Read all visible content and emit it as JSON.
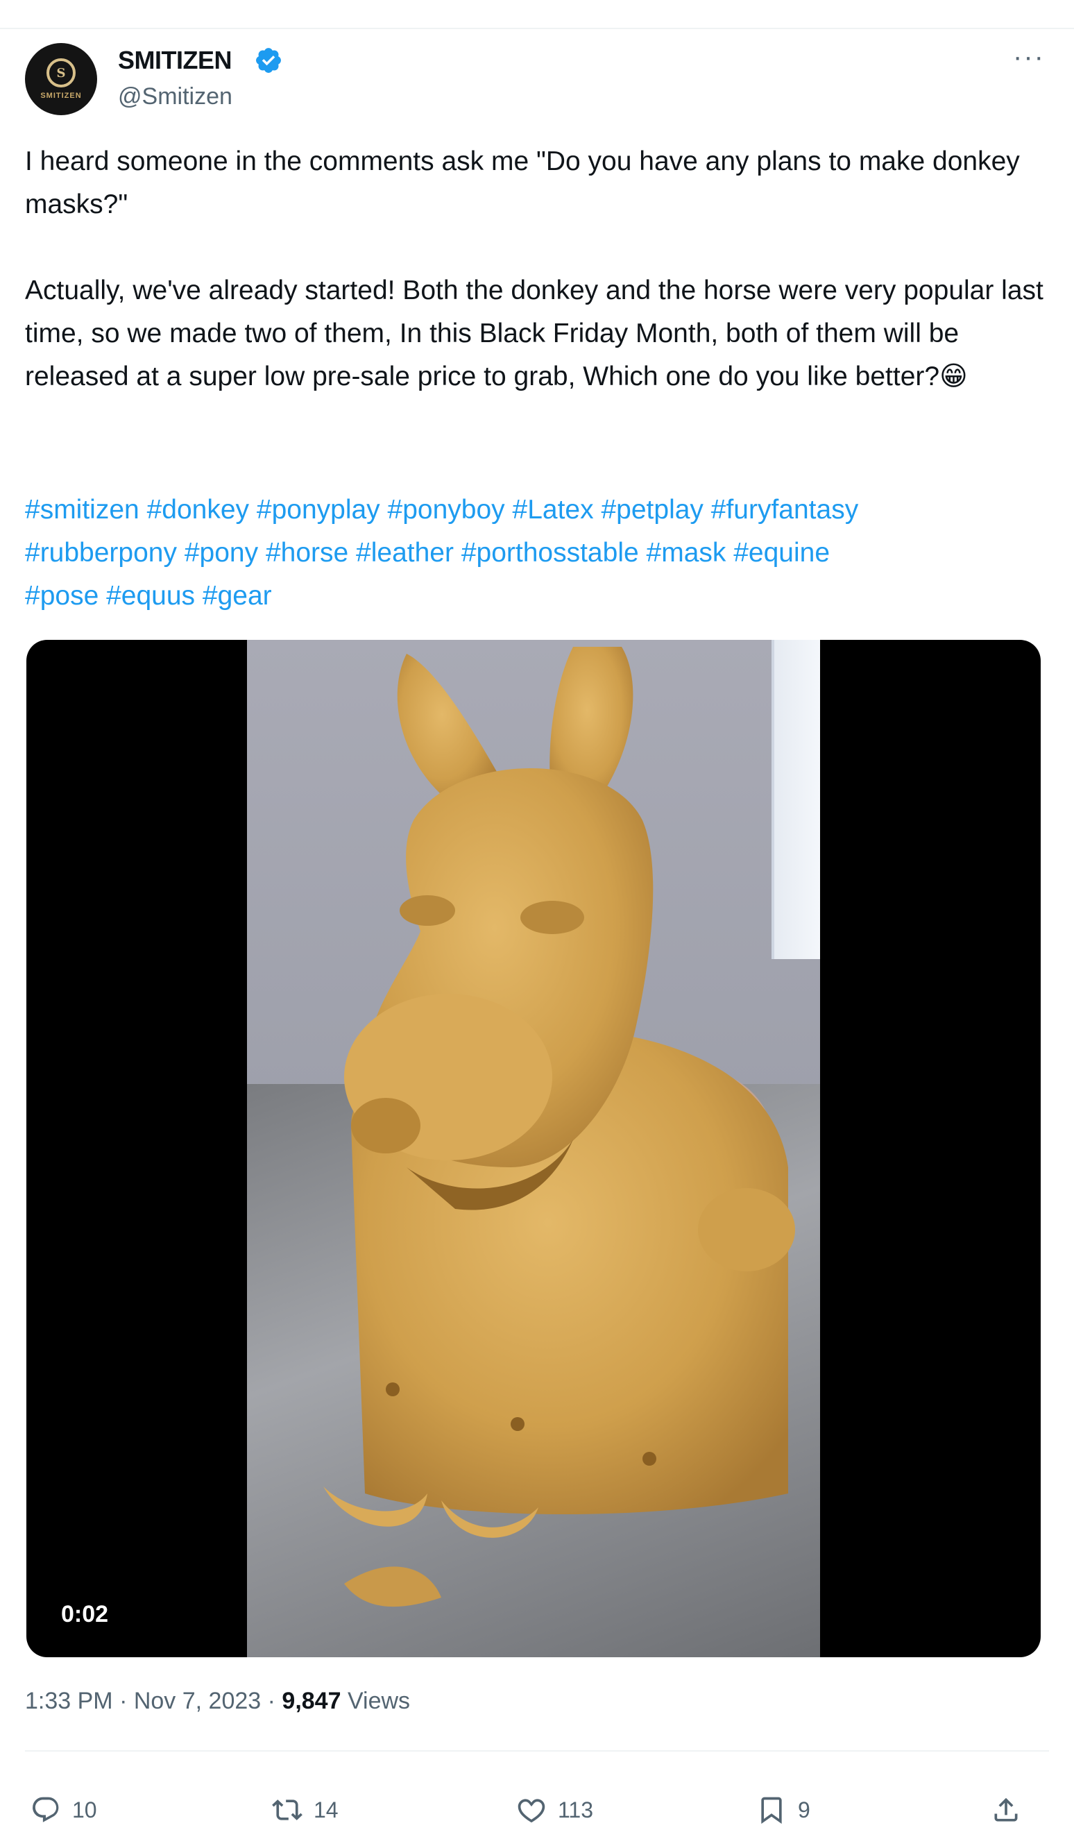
{
  "author": {
    "display_name": "SMITIZEN",
    "handle": "@Smitizen",
    "avatar_text": "SMITIZEN",
    "verified": true
  },
  "tweet": {
    "paragraphs": [
      "I heard someone in the comments ask me \"Do you have any plans to make donkey masks?\"",
      "Actually, we've already started! Both the donkey and the horse were very popular last time, so we made two of them, In this Black Friday Month, both of them will be released at a super low pre-sale price to grab, Which one do you like better?😁"
    ],
    "hashtags": [
      "#smitizen",
      "#donkey",
      "#ponyplay",
      "#ponyboy",
      "#Latex",
      "#petplay",
      "#furyfantasy",
      "#rubberpony",
      "#pony",
      "#horse",
      "#leather",
      "#porthosstable",
      "#mask",
      "#equine",
      "#pose",
      "#equus",
      "#gear"
    ]
  },
  "media": {
    "duration": "0:02"
  },
  "meta": {
    "time": "1:33 PM",
    "separator": " · ",
    "date": "Nov 7, 2023",
    "views_count": "9,847",
    "views_label": "Views"
  },
  "actions": {
    "replies": "10",
    "reposts": "14",
    "likes": "113",
    "bookmarks": "9"
  },
  "colors": {
    "accent": "#1d9bf0",
    "text": "#0f1419",
    "secondary": "#536471",
    "verified": "#1d9bf0"
  }
}
